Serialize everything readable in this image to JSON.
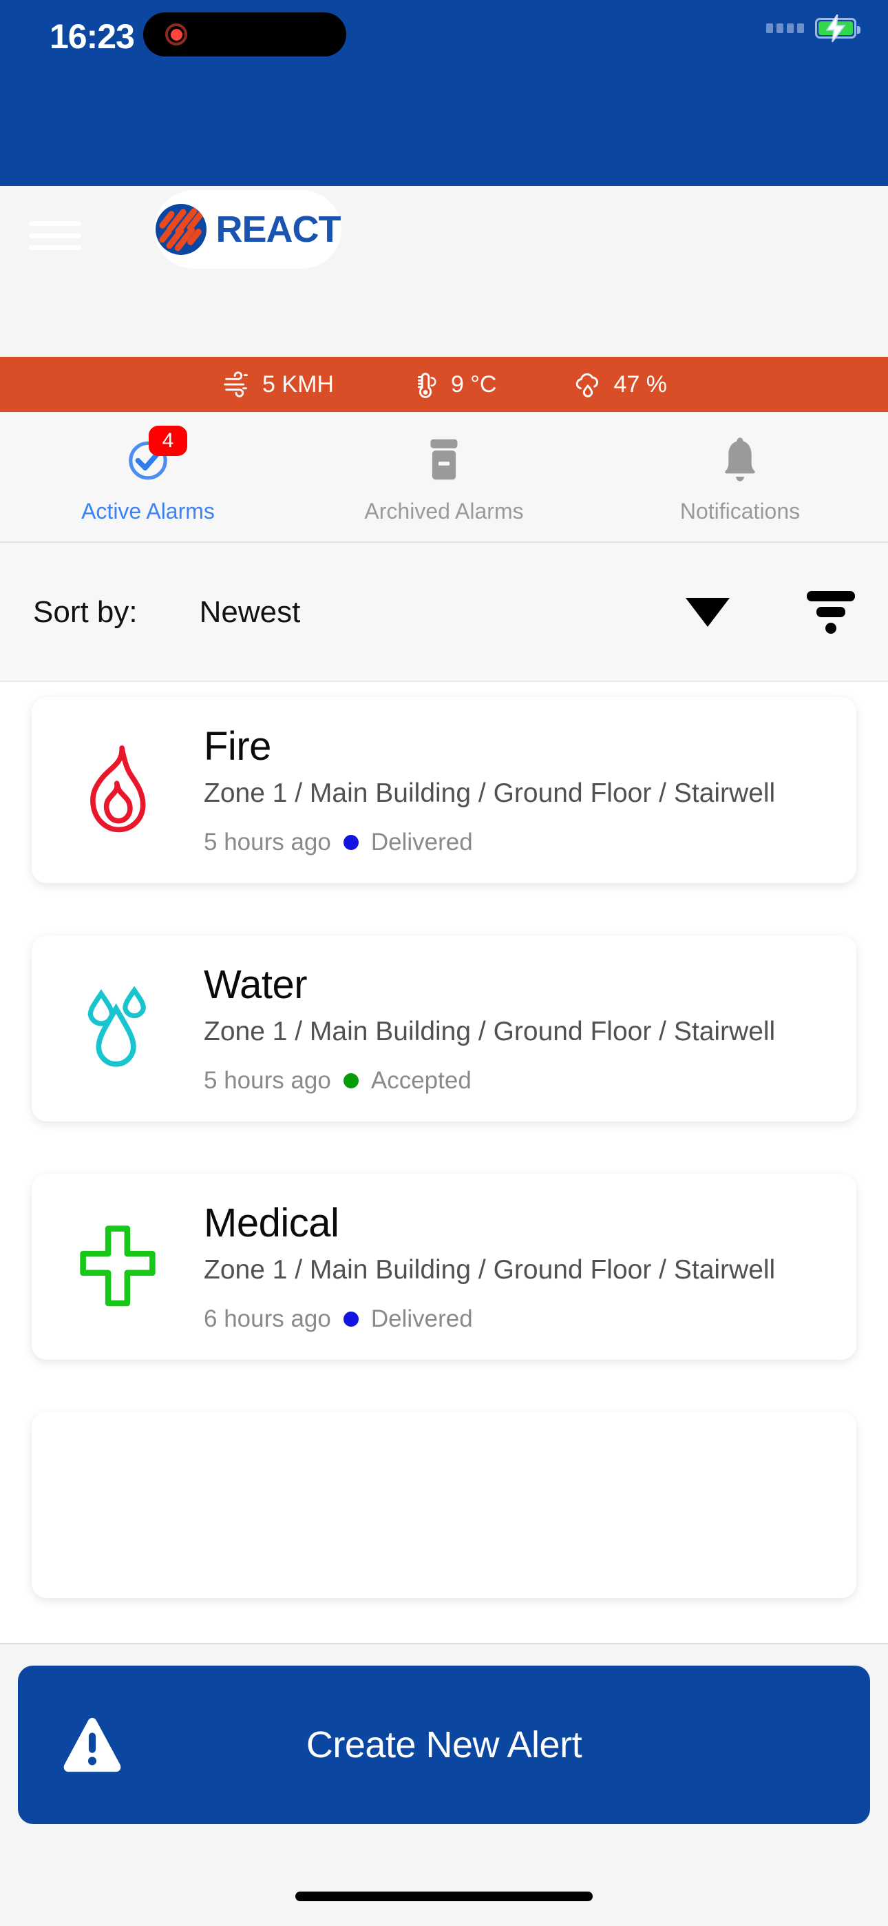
{
  "status_bar": {
    "time": "16:23",
    "recording_indicator": "recording-dot",
    "battery_state": "charging",
    "signal_dots": 4
  },
  "header": {
    "menu_label": "Menu",
    "logo_text": "REACT",
    "brand_blue": "#0B47A1",
    "brand_orange": "#E8491E"
  },
  "weather": {
    "background": "#D94E27",
    "items": [
      {
        "icon": "wind-icon",
        "value": "5 KMH"
      },
      {
        "icon": "thermometer-icon",
        "value": "9 °C"
      },
      {
        "icon": "humidity-cloud-icon",
        "value": "47 %"
      }
    ]
  },
  "tabs": [
    {
      "label": "Active Alarms",
      "icon": "check-circle-icon",
      "badge": "4",
      "active": true
    },
    {
      "label": "Archived Alarms",
      "icon": "archive-box-icon",
      "badge": "",
      "active": false
    },
    {
      "label": "Notifications",
      "icon": "bell-icon",
      "badge": "",
      "active": false
    }
  ],
  "sort": {
    "label": "Sort by:",
    "value": "Newest",
    "caret_icon": "chevron-down-icon",
    "filter_icon": "filter-icon"
  },
  "alarms": [
    {
      "type": "Fire",
      "icon": "flame-icon",
      "icon_color": "#E8172B",
      "location": "Zone 1 / Main Building / Ground Floor / Stairwell",
      "time": "5 hours ago",
      "status": "Delivered",
      "status_color": "#1414E0"
    },
    {
      "type": "Water",
      "icon": "water-drops-icon",
      "icon_color": "#18C5CE",
      "location": "Zone 1 / Main Building / Ground Floor / Stairwell",
      "time": "5 hours ago",
      "status": "Accepted",
      "status_color": "#089C08"
    },
    {
      "type": "Medical",
      "icon": "medical-cross-icon",
      "icon_color": "#18C818",
      "location": "Zone 1 / Main Building / Ground Floor / Stairwell",
      "time": "6 hours ago",
      "status": "Delivered",
      "status_color": "#1414E0"
    }
  ],
  "cta": {
    "label": "Create New Alert",
    "icon": "warning-triangle-icon",
    "background": "#0B47A1"
  }
}
